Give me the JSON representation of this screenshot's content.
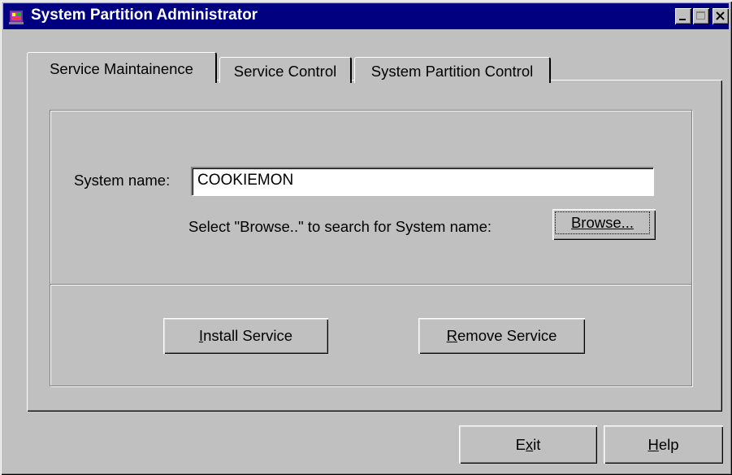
{
  "window": {
    "title": "System Partition Administrator",
    "icon": "app-icon"
  },
  "tabs": [
    {
      "label": "Service Maintainence",
      "active": true
    },
    {
      "label": "Service Control",
      "active": false
    },
    {
      "label": "System Partition Control",
      "active": false
    }
  ],
  "form": {
    "system_name_label": "System name:",
    "system_name_value": "COOKIEMON",
    "browse_hint": "Select \"Browse..\" to search for System name:",
    "browse_label": "Browse...",
    "install_label": "Install Service",
    "install_accel": "I",
    "install_rest": "nstall Service",
    "remove_label": "Remove Service",
    "remove_accel": "R",
    "remove_rest": "emove Service"
  },
  "footer": {
    "exit_label": "Exit",
    "exit_pre": "E",
    "exit_accel": "x",
    "exit_post": "it",
    "help_label": "Help",
    "help_accel": "H",
    "help_rest": "elp"
  },
  "colors": {
    "face": "#c0c0c0",
    "title_bar": "#000080",
    "title_text": "#ffffff"
  }
}
